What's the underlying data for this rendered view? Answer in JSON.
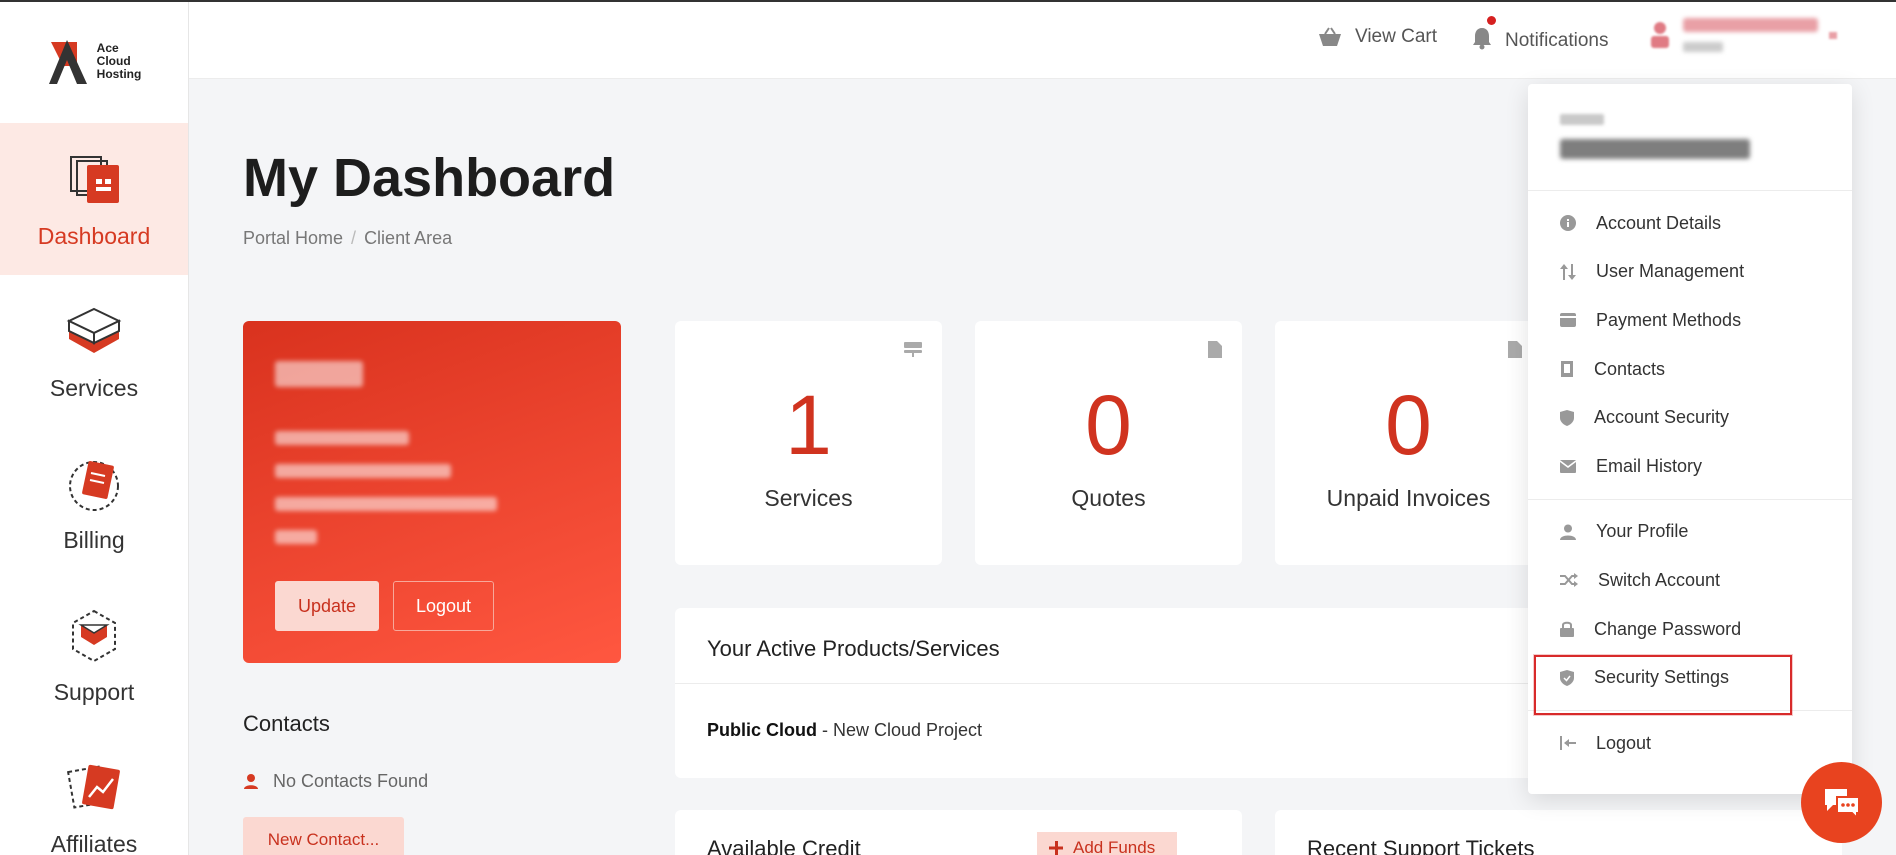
{
  "brand": {
    "logo_text": [
      "Ace",
      "Cloud",
      "Hosting"
    ]
  },
  "sidebar": {
    "items": [
      {
        "label": "Dashboard",
        "icon": "dashboard-icon",
        "active": true
      },
      {
        "label": "Services",
        "icon": "services-icon"
      },
      {
        "label": "Billing",
        "icon": "billing-icon"
      },
      {
        "label": "Support",
        "icon": "support-icon"
      },
      {
        "label": "Affiliates",
        "icon": "affiliates-icon"
      }
    ]
  },
  "header": {
    "cart_label": "View Cart",
    "notifications_label": "Notifications"
  },
  "main": {
    "title": "My Dashboard",
    "breadcrumb": [
      "Portal Home",
      "Client Area"
    ],
    "client_card": {
      "update_label": "Update",
      "logout_label": "Logout"
    },
    "contacts": {
      "title": "Contacts",
      "empty_text": "No Contacts Found",
      "new_label": "New Contact..."
    },
    "stats": [
      {
        "value": "1",
        "label": "Services",
        "icon": "server-icon"
      },
      {
        "value": "0",
        "label": "Quotes",
        "icon": "document-icon"
      },
      {
        "value": "0",
        "label": "Unpaid Invoices",
        "icon": "document-icon"
      }
    ],
    "products": {
      "title": "Your Active Products/Services",
      "item_name": "Public Cloud",
      "item_desc": " - New Cloud Project"
    },
    "credit": {
      "title": "Available Credit",
      "add_label": "Add Funds"
    },
    "tickets": {
      "title": "Recent Support Tickets"
    }
  },
  "dropdown": {
    "group1": [
      {
        "label": "Account Details",
        "icon": "info-icon"
      },
      {
        "label": "User Management",
        "icon": "sort-arrows-icon"
      },
      {
        "label": "Payment Methods",
        "icon": "credit-card-icon"
      },
      {
        "label": "Contacts",
        "icon": "address-book-icon"
      },
      {
        "label": "Account Security",
        "icon": "shield-icon"
      },
      {
        "label": "Email History",
        "icon": "envelope-icon"
      }
    ],
    "group2": [
      {
        "label": "Your Profile",
        "icon": "user-icon"
      },
      {
        "label": "Switch Account",
        "icon": "shuffle-icon"
      },
      {
        "label": "Change Password",
        "icon": "lock-icon"
      },
      {
        "label": "Security Settings",
        "icon": "shield-check-icon",
        "highlighted": true
      }
    ],
    "logout_label": "Logout"
  },
  "colors": {
    "accent": "#d63a22",
    "highlight_box": "#d82a2a"
  }
}
